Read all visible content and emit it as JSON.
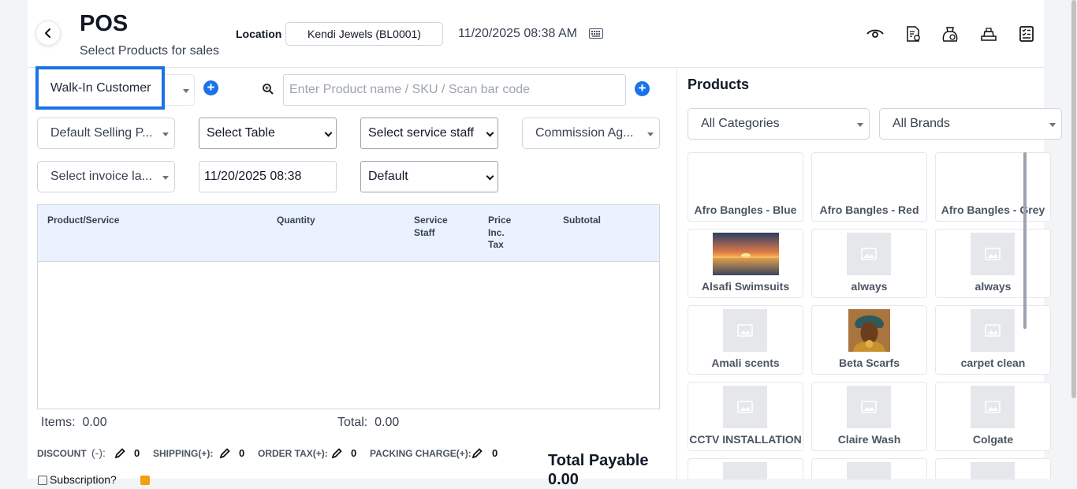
{
  "header": {
    "title": "POS",
    "subtitle": "Select Products for sales",
    "location_label": "Location",
    "location_value": "Kendi Jewels (BL0001)",
    "datetime": "11/20/2025 08:38 AM"
  },
  "form": {
    "customer": "Walk-In Customer",
    "search_placeholder": "Enter Product name / SKU / Scan bar code",
    "selling_price": "Default Selling P...",
    "table": "Select Table",
    "service_staff": "Select service staff",
    "commission_agent": "Commission Ag...",
    "invoice_layout": "Select invoice la...",
    "transaction_date": "11/20/2025 08:38",
    "invoice_scheme": "Default"
  },
  "table": {
    "columns": [
      "Product/Service",
      "Quantity",
      "Service\nStaff",
      "Price\nInc.\nTax",
      "Subtotal"
    ]
  },
  "summary": {
    "items_label": "Items:",
    "items_value": "0.00",
    "total_label": "Total:",
    "total_value": "0.00",
    "discount_label": "DISCOUNT",
    "discount_sign": "(-):",
    "discount_value": "0",
    "shipping_label": "SHIPPING(+):",
    "shipping_value": "0",
    "order_tax_label": "ORDER TAX(+):",
    "order_tax_value": "0",
    "packing_label": "PACKING CHARGE(+):",
    "packing_value": "0",
    "total_payable_label": "Total Payable",
    "total_payable_value": "0.00",
    "subscription_label": "Subscription?"
  },
  "products": {
    "title": "Products",
    "category_filter": "All Categories",
    "brand_filter": "All Brands",
    "items": [
      {
        "name": "Afro Bangles - Blue",
        "image": "none"
      },
      {
        "name": "Afro Bangles - Red",
        "image": "none"
      },
      {
        "name": "Afro Bangles - Grey",
        "image": "none"
      },
      {
        "name": "Alsafi Swimsuits",
        "image": "sunset-photo"
      },
      {
        "name": "always",
        "image": "placeholder"
      },
      {
        "name": "always",
        "image": "placeholder"
      },
      {
        "name": "Amali scents",
        "image": "placeholder"
      },
      {
        "name": "Beta Scarfs",
        "image": "portrait-photo"
      },
      {
        "name": "carpet clean",
        "image": "placeholder"
      },
      {
        "name": "CCTV INSTALLATION",
        "image": "placeholder"
      },
      {
        "name": "Claire Wash",
        "image": "placeholder"
      },
      {
        "name": "Colgate",
        "image": "placeholder"
      },
      {
        "name": "",
        "image": "placeholder"
      },
      {
        "name": "",
        "image": "placeholder"
      },
      {
        "name": "",
        "image": "placeholder"
      }
    ]
  },
  "colors": {
    "accent": "#1a73e8",
    "table_header_bg": "#eaf3fd"
  }
}
